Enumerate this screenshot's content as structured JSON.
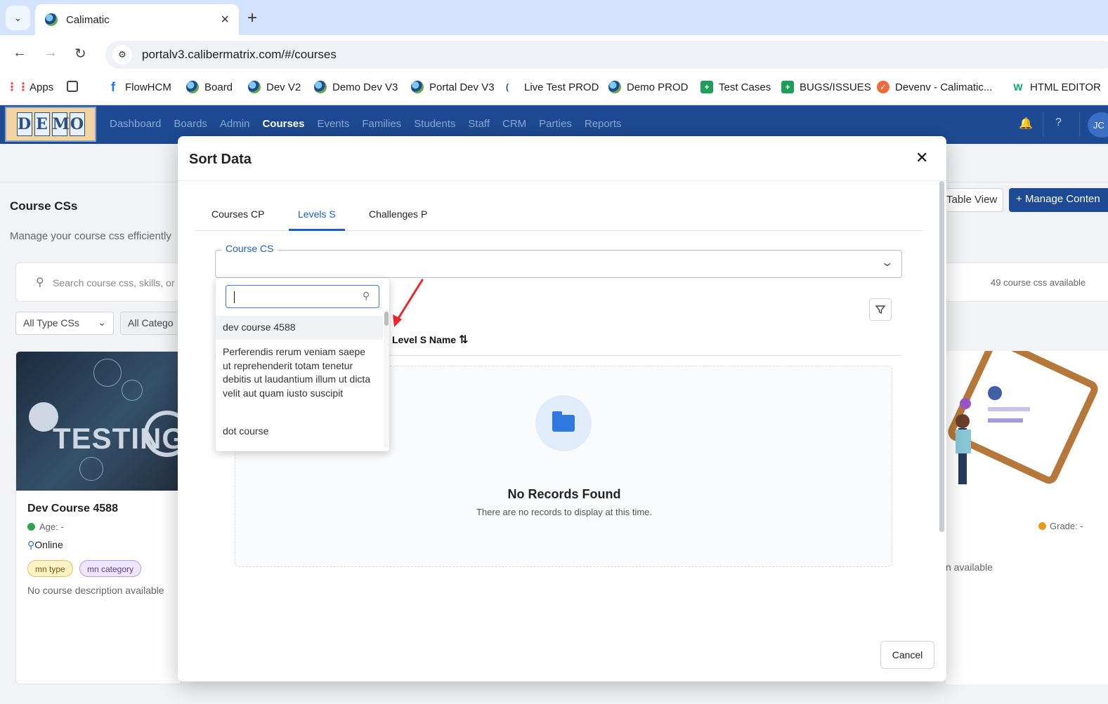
{
  "browser": {
    "tab_title": "Calimatic",
    "url": "portalv3.calibermatrix.com/#/courses",
    "bookmarks": [
      {
        "label": "Apps",
        "icon": "apps-grid-icon"
      },
      {
        "label": "",
        "icon": "tab-groups-icon"
      },
      {
        "label": "FlowHCM",
        "icon": "flowhcm-icon"
      },
      {
        "label": "Board",
        "icon": "globe-icon"
      },
      {
        "label": "Dev V2",
        "icon": "globe-icon"
      },
      {
        "label": "Demo Dev V3",
        "icon": "globe-icon"
      },
      {
        "label": "Portal Dev V3",
        "icon": "globe-icon"
      },
      {
        "label": "Live Test PROD",
        "icon": "globe-icon"
      },
      {
        "label": "Demo PROD",
        "icon": "globe-icon"
      },
      {
        "label": "Test Cases",
        "icon": "sheets-icon"
      },
      {
        "label": "BUGS/ISSUES",
        "icon": "sheets-icon"
      },
      {
        "label": "Devenv - Calimatic...",
        "icon": "devenv-icon"
      },
      {
        "label": "HTML EDITOR",
        "icon": "w3schools-icon"
      }
    ]
  },
  "app": {
    "logo_letters": [
      "D",
      "E",
      "M",
      "O"
    ],
    "nav": [
      "Dashboard",
      "Boards",
      "Admin",
      "Courses",
      "Events",
      "Families",
      "Students",
      "Staff",
      "CRM",
      "Parties",
      "Reports"
    ],
    "active_nav": "Courses",
    "avatar_initials": "JC"
  },
  "page": {
    "title": "Course CSs",
    "subtitle": "Manage your course css efficiently",
    "search_placeholder": "Search course css, skills, or",
    "available_text": "49 course css available",
    "filter_type": "All Type CSs",
    "filter_category": "All Catego",
    "table_view_label": "Table View",
    "manage_label": "Manage Conten",
    "card": {
      "title": "Dev Course 4588",
      "age": "Age: -",
      "mode": "Online",
      "tag_type": "mn type",
      "tag_category": "mn category",
      "description": "No course description available",
      "image_text": "TESTING"
    },
    "right_card": {
      "grade": "Grade: -",
      "description_fragment": "n available"
    }
  },
  "modal": {
    "title": "Sort Data",
    "tabs": [
      "Courses CP",
      "Levels S",
      "Challenges P"
    ],
    "active_tab": "Levels S",
    "select_label": "Course CS",
    "column_header": "Level S Name",
    "empty_title": "No Records Found",
    "empty_sub": "There are no records to display at this time.",
    "cancel_label": "Cancel"
  },
  "dropdown": {
    "search_value": "",
    "options": [
      "dev course 4588",
      "Perferendis rerum veniam saepe ut reprehenderit totam tenetur debitis ut laudantium illum ut dicta velit aut quam iusto suscipit",
      "dot course"
    ],
    "highlighted_index": 0
  },
  "colors": {
    "header_bg": "#1d4a92",
    "accent": "#1d5fbf",
    "annotation_arrow": "#e8262b"
  }
}
